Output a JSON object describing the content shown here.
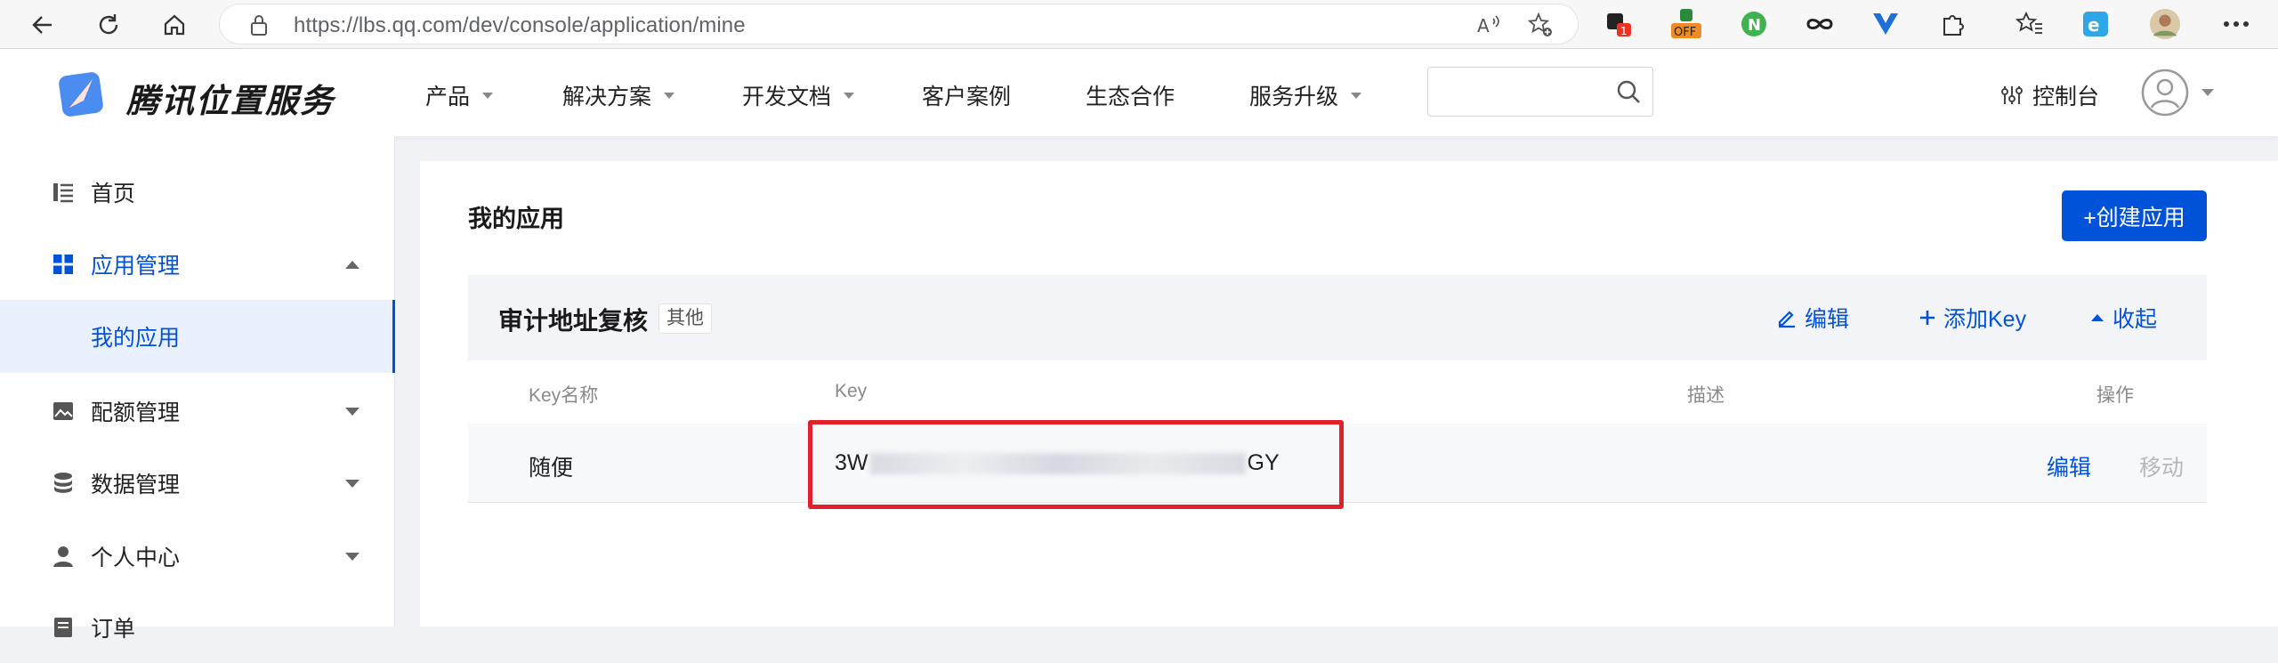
{
  "browser": {
    "url": "https://lbs.qq.com/dev/console/application/mine",
    "ext_badges": {
      "ext1": "1",
      "ext2": "OFF",
      "ext3": "N"
    }
  },
  "site": {
    "logo_text": "腾讯位置服务",
    "menu": [
      {
        "label": "产品",
        "has_dropdown": true
      },
      {
        "label": "解决方案",
        "has_dropdown": true
      },
      {
        "label": "开发文档",
        "has_dropdown": true
      },
      {
        "label": "客户案例",
        "has_dropdown": false
      },
      {
        "label": "生态合作",
        "has_dropdown": false
      },
      {
        "label": "服务升级",
        "has_dropdown": true
      }
    ],
    "search": {
      "placeholder": ""
    },
    "console_label": "控制台"
  },
  "sidebar": {
    "items": [
      {
        "label": "首页",
        "icon": "home-list-icon"
      },
      {
        "label": "应用管理",
        "icon": "grid-apps-icon",
        "expanded": true
      },
      {
        "label": "我的应用",
        "icon": "",
        "active": true
      },
      {
        "label": "配额管理",
        "icon": "image-quota-icon"
      },
      {
        "label": "数据管理",
        "icon": "database-icon"
      },
      {
        "label": "个人中心",
        "icon": "user-icon"
      },
      {
        "label": "订单",
        "icon": "order-icon"
      }
    ]
  },
  "main": {
    "title": "我的应用",
    "create_button": "+创建应用",
    "app": {
      "name": "审计地址复核",
      "tag": "其他",
      "actions": {
        "edit": "编辑",
        "add_key": "添加Key",
        "collapse": "收起"
      }
    },
    "table": {
      "headers": {
        "key_name": "Key名称",
        "key": "Key",
        "desc": "描述",
        "ops": "操作"
      },
      "rows": [
        {
          "key_name": "随便",
          "key_prefix": "3W",
          "key_suffix": "GY",
          "desc": "",
          "edit": "编辑",
          "move": "移动"
        }
      ]
    }
  },
  "colors": {
    "accent": "#0052d9",
    "highlight": "#e0202a"
  }
}
